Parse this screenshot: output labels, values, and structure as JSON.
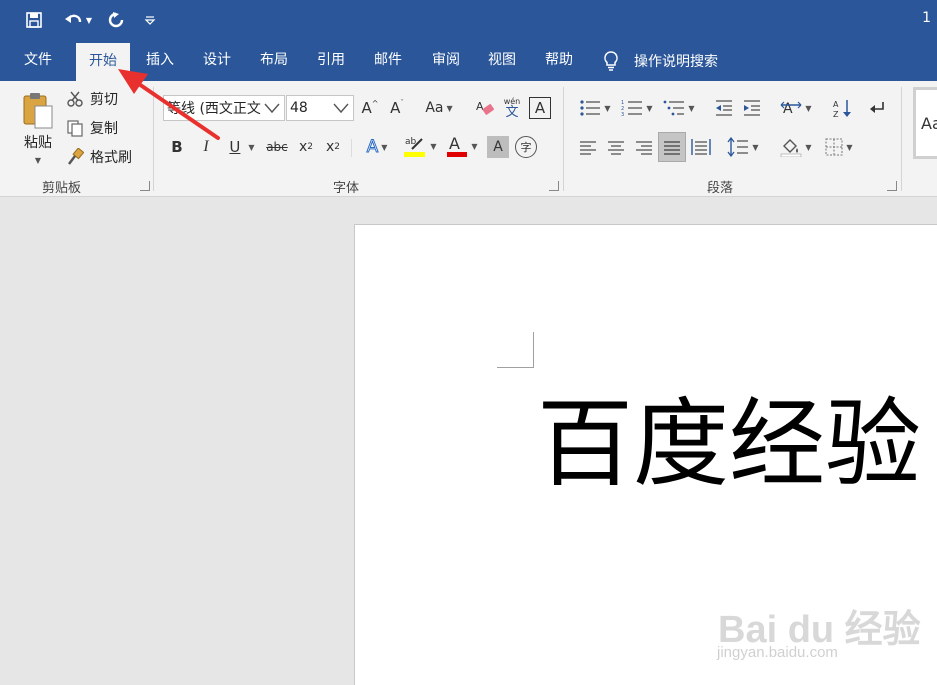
{
  "title_bar": {
    "page_indicator": "1"
  },
  "tabs": [
    {
      "label": "文件",
      "active": false
    },
    {
      "label": "开始",
      "active": true
    },
    {
      "label": "插入",
      "active": false
    },
    {
      "label": "设计",
      "active": false
    },
    {
      "label": "布局",
      "active": false
    },
    {
      "label": "引用",
      "active": false
    },
    {
      "label": "邮件",
      "active": false
    },
    {
      "label": "审阅",
      "active": false
    },
    {
      "label": "视图",
      "active": false
    },
    {
      "label": "帮助",
      "active": false
    }
  ],
  "tell_me": {
    "label": "操作说明搜索",
    "icon": "lightbulb-icon"
  },
  "clipboard": {
    "group_label": "剪贴板",
    "paste_label": "粘贴",
    "cut_label": "剪切",
    "copy_label": "复制",
    "format_painter_label": "格式刷"
  },
  "font": {
    "group_label": "字体",
    "font_name": "等线 (西文正文",
    "font_size": "48",
    "change_case_label": "Aa",
    "grow_label": "A",
    "shrink_label": "A",
    "phonetic_top": "wén",
    "phonetic_bottom": "文",
    "bold": "B",
    "italic": "I",
    "underline": "U",
    "strike": "abc",
    "subscript": "x",
    "subscript_mark": "2",
    "superscript": "x",
    "superscript_mark": "2",
    "highlight_color": "#ffff00",
    "font_color": "#e00000",
    "enclose": "字"
  },
  "paragraph": {
    "group_label": "段落"
  },
  "styles": {
    "preview_label": "Aa"
  },
  "document": {
    "text": "百度经验"
  },
  "watermark": {
    "logo": "Bai du 经验",
    "url": "jingyan.baidu.com"
  },
  "colors": {
    "brand": "#2b579a",
    "ribbon": "#f3f3f3",
    "annotation": "#e8312e"
  }
}
